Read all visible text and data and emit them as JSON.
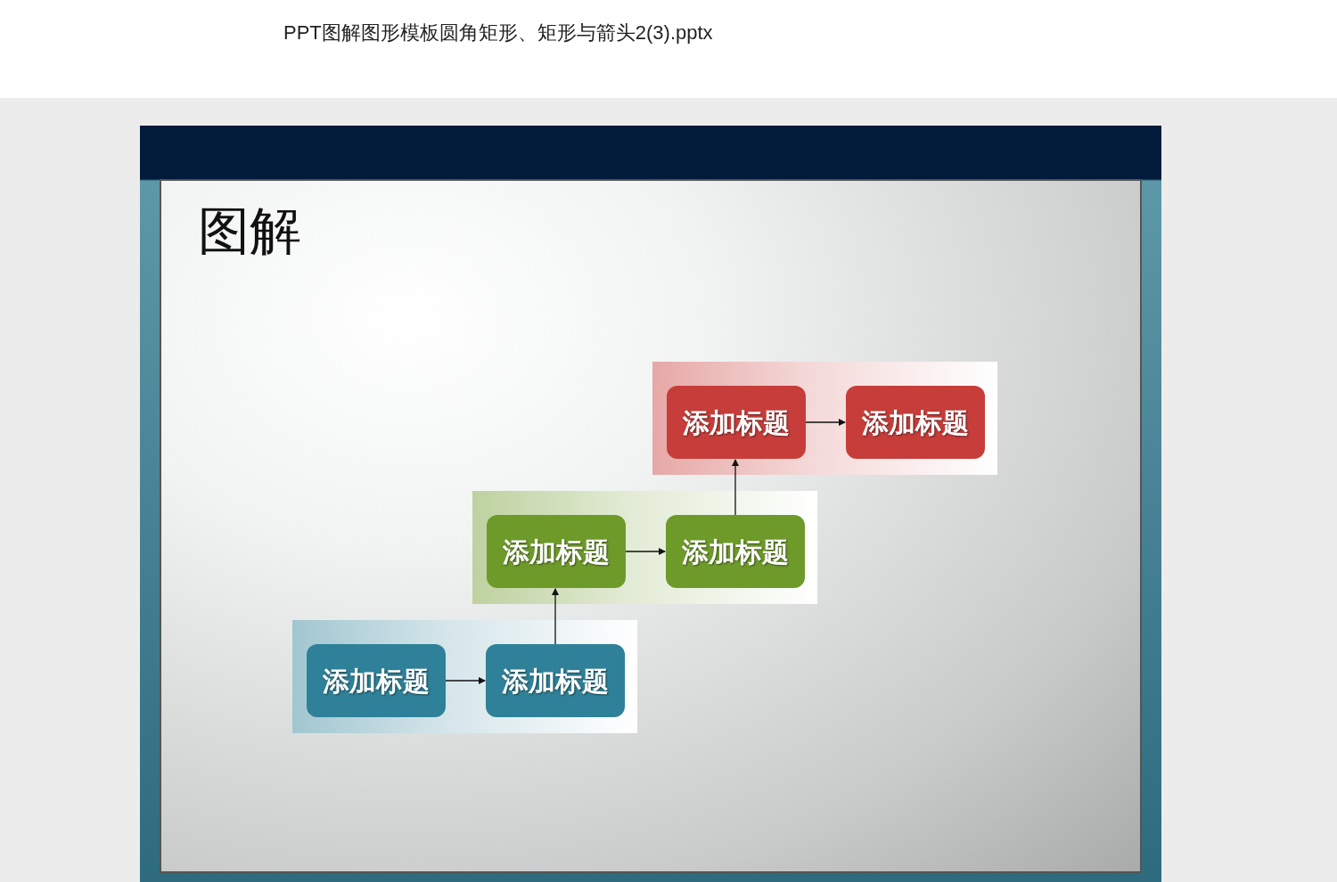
{
  "document": {
    "filename": "PPT图解图形模板圆角矩形、矩形与箭头2(3).pptx"
  },
  "slide": {
    "title": "图解",
    "stages": [
      {
        "color": "#2e8198",
        "boxes": [
          "添加标题",
          "添加标题"
        ]
      },
      {
        "color": "#6e9a2a",
        "boxes": [
          "添加标题",
          "添加标题"
        ]
      },
      {
        "color": "#c63d3a",
        "boxes": [
          "添加标题",
          "添加标题"
        ]
      }
    ]
  }
}
